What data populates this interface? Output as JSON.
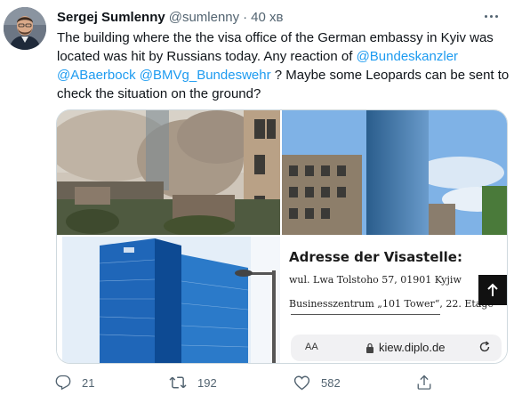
{
  "tweet": {
    "author_name": "Sergej Sumlenny",
    "author_handle": "@sumlenny",
    "separator": "·",
    "time": "40 хв",
    "text": {
      "line1": "The building where the the visa office of the German embassy in Kyiv was",
      "line2": "located was hit by Russians today. Any reaction of ",
      "mention1": "@Bundeskanzler",
      "mention2": "@ABaerbock",
      "mention3": "@BMVg_Bundeswehr",
      "line3_rest": " ? Maybe some Leopards can be sent to",
      "line4": "check the situation on the ground?"
    }
  },
  "media": {
    "visa_card": {
      "title": "Adresse der Visastelle:",
      "address": "wul. Lwa Tolstoho 57, 01901 Kyjiw",
      "business_center": "Businesszentrum „101 Tower“, 22. Etage",
      "url_aa": "AA",
      "url_host": "kiew.diplo.de"
    }
  },
  "actions": {
    "replies": "21",
    "retweets": "192",
    "likes": "582"
  },
  "icons": {
    "more": "more-horizontal-icon",
    "reply": "reply-icon",
    "retweet": "retweet-icon",
    "like": "heart-icon",
    "share": "share-icon",
    "lock": "lock-icon",
    "reload": "reload-icon",
    "scroll_top": "arrow-up-icon"
  },
  "colors": {
    "link": "#1d9bf0",
    "secondary_text": "#536471",
    "primary_text": "#0f1419"
  }
}
